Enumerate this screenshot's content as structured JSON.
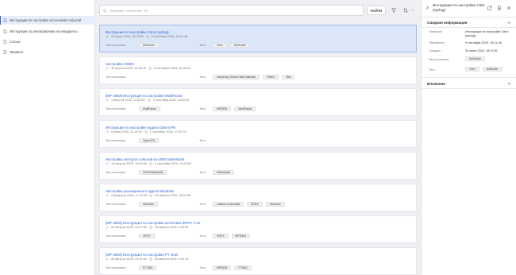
{
  "sidebar": {
    "items": [
      {
        "label": "Инструкции по настройке источников событий",
        "icon": "document-icon",
        "active": true
      },
      {
        "label": "Инструкции по реагированию на инциденты",
        "icon": "document-icon",
        "active": false
      },
      {
        "label": "Статьи",
        "icon": "document-icon",
        "active": false
      },
      {
        "label": "Правила",
        "icon": "document-icon",
        "active": false
      }
    ]
  },
  "search": {
    "placeholder": "Название, Описание, Тег",
    "button_label": "НАЙТИ",
    "value": ""
  },
  "labels": {
    "source_type": "Тип источника",
    "tags": "Теги"
  },
  "items": [
    {
      "title": "Инструкция по настройке Citrix (syslog)",
      "created": "30 июня 2025, 18:11:55",
      "updated": "9 сентября 2025, 16:21:46",
      "source_tags": [
        "NetScaler"
      ],
      "tags": [
        "Citrix",
        "NetScaler"
      ],
      "selected": true
    },
    {
      "title": "Настройка KSMG",
      "created": "30 апреля 2025, 16:32:15",
      "updated": "8 сентября 2025, 20:36:30",
      "source_tags": [],
      "tags": [
        "Kaspersky Secure Mail Gateway",
        "KSMG",
        "Mail"
      ],
      "selected": false
    },
    {
      "title": "[MP SIEM] Инструкция по настройке MultiFactor",
      "created": "1 августа 2025, 12:52:55",
      "updated": "3 сентября 2025, 16:02:50",
      "source_tags": [
        "MultiFactor"
      ],
      "tags": [
        "MPSIEM",
        "MultiFactor"
      ],
      "selected": false
    },
    {
      "title": "Инструкция по настройке аудита OpenVPN",
      "created": "5 июня 2025, 12:13:39",
      "updated": "1 сентября 2025, 17:02:15",
      "source_tags": [
        "OpenVPN"
      ],
      "tags": [],
      "selected": false
    },
    {
      "title": "Настройка экспорта событий из UEM SafeMobile",
      "created": "14 августа 2025, 19:06:56",
      "updated": "1 сентября 2025, 13:16:38",
      "source_tags": [
        "UEM SafeMobile"
      ],
      "tags": [
        "SafeMobile"
      ],
      "selected": false
    },
    {
      "title": "Настройка расширенного аудита Windows",
      "created": "8 февраля 2025, 17:13:36",
      "updated": "29 августа 2025, 18:04:05",
      "source_tags": [
        "Windows"
      ],
      "tags": [
        "shadow credentials",
        "SDDO",
        "Windows"
      ],
      "selected": false
    },
    {
      "title": "[MP SIEM] Инструкция по настройке источника ФПСУ 3.10",
      "created": "28 августа 2025, 21:07:56",
      "updated": "28 августа 2025, 6:18:04",
      "source_tags": [
        "ФПСУ"
      ],
      "tags": [
        "ФПСУ",
        "MPSIEM"
      ],
      "selected": false
    },
    {
      "title": "[MP SIEM] Инструкция по настройке PT NAD",
      "created": "28 августа 2025, 20:37:40",
      "updated": "28 августа 2025, 4:33:13",
      "source_tags": [
        "PT NAD"
      ],
      "tags": [
        "MPSIEM",
        "PTNAD"
      ],
      "selected": false
    }
  ],
  "detail": {
    "title": "Инструкция по настройке Citrix (syslog)",
    "summary_label": "Сводная информация",
    "fields": [
      {
        "key": "Название",
        "value": "Инструкция по настройке Citrix (syslog)"
      },
      {
        "key": "Обновлено",
        "value": "9 сентября 2025, 16:21:46"
      },
      {
        "key": "Создано",
        "value": "30 июня 2025, 18:11:55"
      }
    ],
    "source_type_key": "Тип источника",
    "source_tags": [
      "NetScaler"
    ],
    "tags_key": "Теги",
    "tags": [
      "Citrix",
      "NetScaler"
    ],
    "attachments_label": "Вложения"
  },
  "colors": {
    "accent": "#2f64d1",
    "selected_bg": "#dbe6f8",
    "page_bg": "#eef0f3"
  }
}
